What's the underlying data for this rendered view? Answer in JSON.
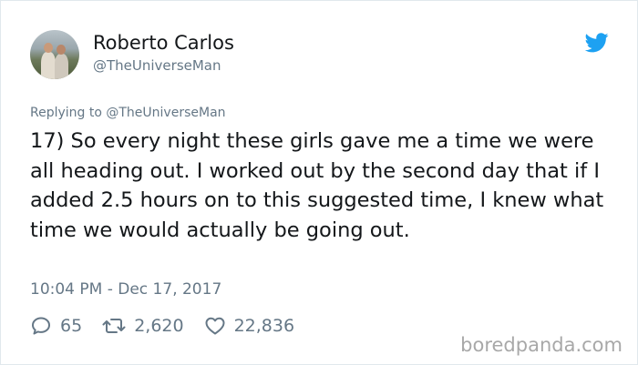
{
  "author": {
    "name": "Roberto Carlos",
    "handle": "@TheUniverseMan"
  },
  "replying_to": "Replying to @TheUniverseMan",
  "tweet_text": "17) So every night these girls gave me a time we were all heading out. I worked out by the second day that if I added 2.5 hours on to this suggested time, I knew what time we would actually be going out.",
  "timestamp": "10:04 PM - Dec 17, 2017",
  "actions": {
    "replies": "65",
    "retweets": "2,620",
    "likes": "22,836"
  },
  "watermark": "boredpanda.com",
  "icons": {
    "brand": "twitter-bird-icon",
    "reply": "reply-icon",
    "retweet": "retweet-icon",
    "like": "heart-icon"
  },
  "colors": {
    "twitter_blue": "#1da1f2",
    "secondary_text": "#657786",
    "primary_text": "#14171a"
  }
}
